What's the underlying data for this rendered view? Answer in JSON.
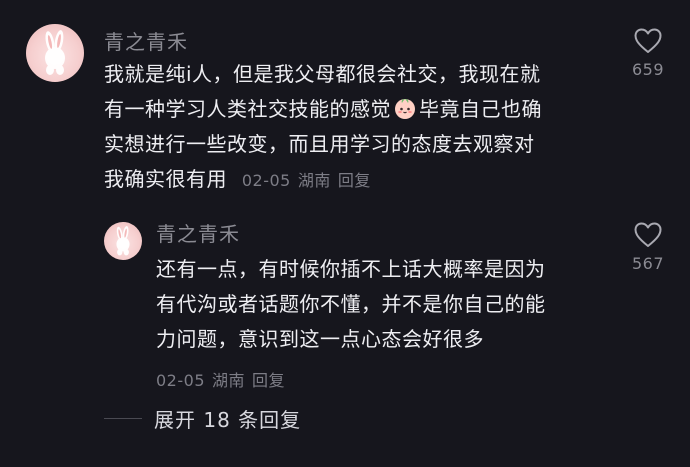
{
  "comment": {
    "username": "青之青禾",
    "lines": [
      "我就是纯i人，但是我父母都很会社交，我现在就",
      "有一种学习人类社交技能的感觉",
      "毕竟自己也确",
      "实想进行一些改变，而且用学习的态度去观察对",
      "我确实很有用"
    ],
    "emoji_icon": "peach-face-emoji",
    "date": "02-05",
    "location": "湖南",
    "reply_label": "回复",
    "like_count": "659"
  },
  "reply": {
    "username": "青之青禾",
    "lines": [
      "还有一点，有时候你插不上话大概率是因为",
      "有代沟或者话题你不懂，并不是你自己的能",
      "力问题，意识到这一点心态会好很多"
    ],
    "date": "02-05",
    "location": "湖南",
    "reply_label": "回复",
    "like_count": "567"
  },
  "expand_replies": "展开 18 条回复",
  "icons": {
    "like": "heart-outline-icon",
    "avatar": "bunny-avatar-icon"
  },
  "colors": {
    "background": "#16161d",
    "text": "#eeeef2",
    "muted": "#7d7d86"
  }
}
